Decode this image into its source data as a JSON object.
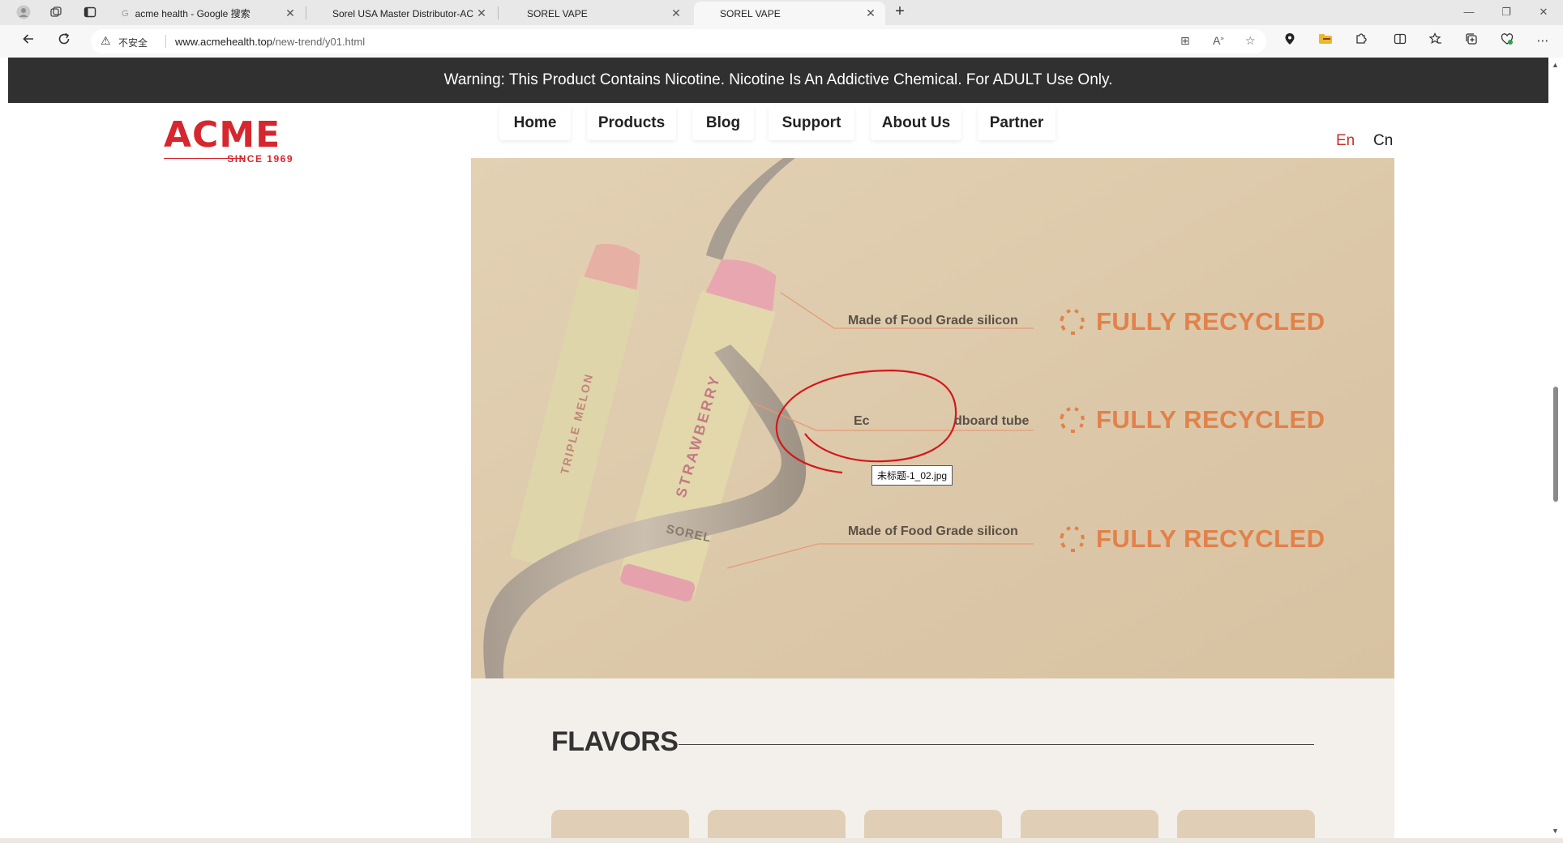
{
  "browser": {
    "tabs": [
      {
        "title": "acme health - Google 搜索",
        "active": false,
        "favicon": "G"
      },
      {
        "title": "Sorel USA Master Distributor-AC",
        "active": false,
        "favicon": ""
      },
      {
        "title": "SOREL VAPE",
        "active": false,
        "favicon": ""
      },
      {
        "title": "SOREL VAPE",
        "active": true,
        "favicon": ""
      }
    ],
    "address": {
      "security_label": "不安全",
      "url_host": "www.acmehealth.top",
      "url_path": "/new-trend/y01.html"
    },
    "icons": {
      "profile": "profile-icon",
      "workspaces": "workspaces-icon",
      "tab_actions": "tab-actions-icon",
      "back": "back-icon",
      "refresh": "refresh-icon",
      "read_aloud": "read-aloud-icon",
      "favorite": "star-icon",
      "extensions": "puzzle-icon",
      "menu": "more-icon"
    }
  },
  "page": {
    "warning": "Warning: This Product Contains Nicotine. Nicotine Is An Addictive Chemical. For ADULT Use Only.",
    "logo": {
      "name": "ACME",
      "since": "SINCE 1969"
    },
    "nav": [
      "Home",
      "Products",
      "Blog",
      "Support",
      "About Us",
      "Partner"
    ],
    "languages": {
      "en": "En",
      "cn": "Cn"
    },
    "hero": {
      "product_labels": [
        "TRIPLE MELON",
        "STRAWBERRY",
        "SOREL"
      ],
      "features": [
        {
          "label": "Made of Food Grade silicon",
          "badge": "FULLY RECYCLED"
        },
        {
          "label": "Eco-friendly Cardboard tube",
          "label_visible_left": "Ec",
          "label_visible_right": "dboard tube",
          "badge": "FULLY RECYCLED"
        },
        {
          "label": "Made of Food Grade silicon",
          "badge": "FULLY RECYCLED"
        }
      ],
      "tooltip": "未标题-1_02.jpg"
    },
    "flavors": {
      "title": "FLAVORS",
      "card_count": 5
    }
  },
  "colors": {
    "brand_red": "#d6262e",
    "warning_bg": "#303030",
    "hero_bg": "#ddc9aa",
    "recycle_orange": "#e2814a",
    "annotation_red": "#d6161c"
  }
}
